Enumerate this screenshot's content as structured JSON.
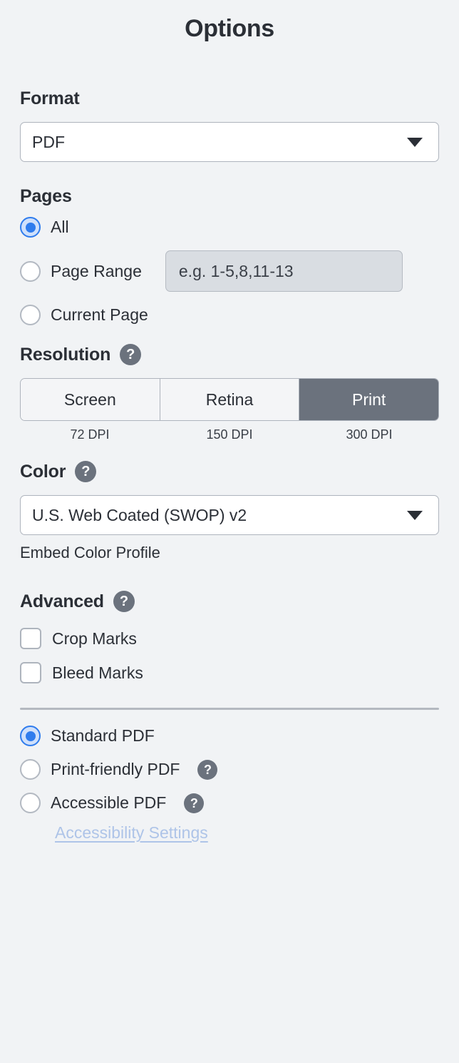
{
  "panel": {
    "title": "Options"
  },
  "format": {
    "heading": "Format",
    "selected": "PDF"
  },
  "pages": {
    "heading": "Pages",
    "options": [
      {
        "label": "All",
        "selected": true
      },
      {
        "label": "Page Range",
        "selected": false
      },
      {
        "label": "Current Page",
        "selected": false
      }
    ],
    "range_placeholder": "e.g. 1-5,8,11-13"
  },
  "resolution": {
    "heading": "Resolution",
    "help": "?",
    "segments": [
      {
        "label": "Screen",
        "dpi": "72 DPI",
        "active": false
      },
      {
        "label": "Retina",
        "dpi": "150 DPI",
        "active": false
      },
      {
        "label": "Print",
        "dpi": "300 DPI",
        "active": true
      }
    ]
  },
  "color": {
    "heading": "Color",
    "help": "?",
    "selected": "U.S. Web Coated (SWOP) v2",
    "embed_label": "Embed Color Profile"
  },
  "advanced": {
    "heading": "Advanced",
    "help": "?",
    "checkboxes": [
      {
        "label": "Crop Marks",
        "checked": false
      },
      {
        "label": "Bleed Marks",
        "checked": false
      }
    ]
  },
  "pdf_type": {
    "options": [
      {
        "label": "Standard PDF",
        "selected": true,
        "help": null
      },
      {
        "label": "Print-friendly PDF",
        "selected": false,
        "help": "?"
      },
      {
        "label": "Accessible PDF",
        "selected": false,
        "help": "?"
      }
    ],
    "accessibility_link": "Accessibility Settings"
  },
  "colors": {
    "background": "#f1f3f5",
    "accent_blue": "#2f7ced",
    "accent_blue_light": "#cfe0fb",
    "segment_active": "#6b727d",
    "help_icon": "#6b727d",
    "link_muted": "#aec4e8",
    "text": "#2b2f36",
    "border": "#aeb4bd",
    "input_disabled": "#d9dde2"
  }
}
